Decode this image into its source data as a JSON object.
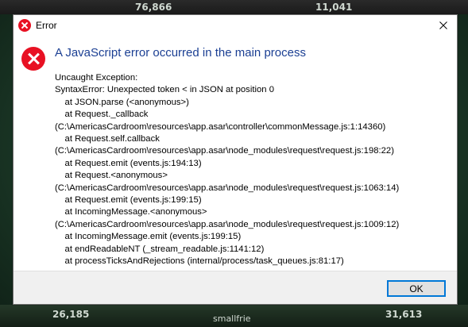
{
  "background": {
    "stats": [
      "76,866",
      "11,041",
      "26,185",
      "smallfrie",
      "31,613"
    ]
  },
  "dialog": {
    "title": "Error",
    "heading": "A JavaScript error occurred in the main process",
    "lines": [
      "Uncaught Exception:",
      "SyntaxError: Unexpected token < in JSON at position 0",
      "    at JSON.parse (<anonymous>)",
      "    at Request._callback",
      "(C:\\AmericasCardroom\\resources\\app.asar\\controller\\commonMessage.js:1:14360)",
      "    at Request.self.callback",
      "(C:\\AmericasCardroom\\resources\\app.asar\\node_modules\\request\\request.js:198:22)",
      "    at Request.emit (events.js:194:13)",
      "    at Request.<anonymous>",
      "(C:\\AmericasCardroom\\resources\\app.asar\\node_modules\\request\\request.js:1063:14)",
      "    at Request.emit (events.js:199:15)",
      "    at IncomingMessage.<anonymous>",
      "(C:\\AmericasCardroom\\resources\\app.asar\\node_modules\\request\\request.js:1009:12)",
      "    at IncomingMessage.emit (events.js:199:15)",
      "    at endReadableNT (_stream_readable.js:1141:12)",
      "    at processTicksAndRejections (internal/process/task_queues.js:81:17)"
    ],
    "ok_label": "OK",
    "icons": {
      "title": "error-icon",
      "close": "close-icon",
      "main": "error-icon"
    },
    "colors": {
      "error_red": "#e81123",
      "heading_blue": "#1b3f93",
      "button_border": "#0078d7"
    }
  }
}
